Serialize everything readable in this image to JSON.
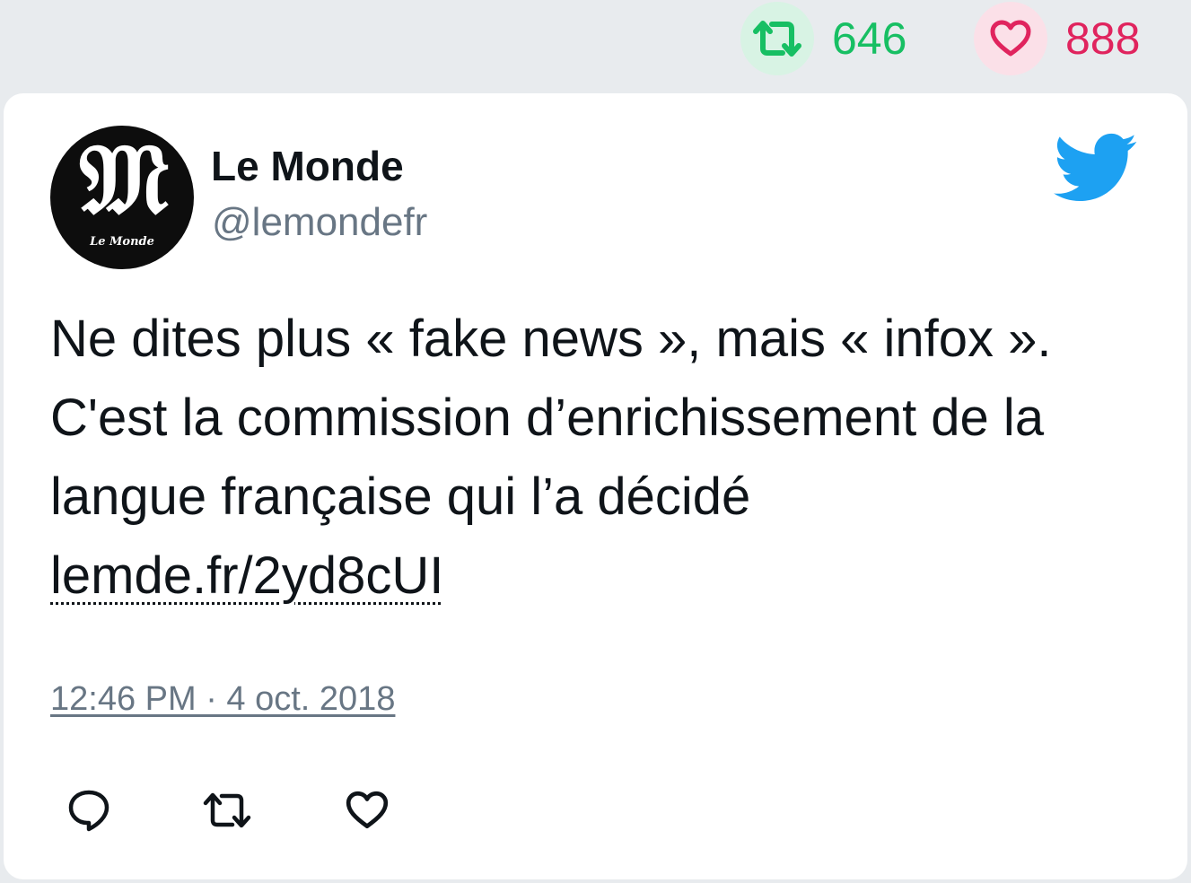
{
  "stats": {
    "retweets": {
      "icon": "retweet-icon",
      "count": "646",
      "color": "#17bf63"
    },
    "likes": {
      "icon": "heart-icon",
      "count": "888",
      "color": "#e0245e"
    }
  },
  "tweet": {
    "author": {
      "name": "Le Monde",
      "handle": "@lemondefr",
      "avatar_icon": "le-monde-logo"
    },
    "brand_icon": "twitter-bird-icon",
    "text": "Ne dites plus « fake news », mais « infox ». C'est la commission d’enrichissement de la langue française qui l’a décidé",
    "link": "lemde.fr/2yd8cUI",
    "timestamp": "12:46 PM · 4 oct. 2018",
    "actions": {
      "reply_icon": "reply-icon",
      "retweet_icon": "retweet-icon",
      "like_icon": "heart-icon"
    }
  },
  "colors": {
    "twitter_blue": "#1da1f2",
    "text": "#0f1419",
    "secondary_text": "#687684",
    "background": "#e8ebee"
  }
}
